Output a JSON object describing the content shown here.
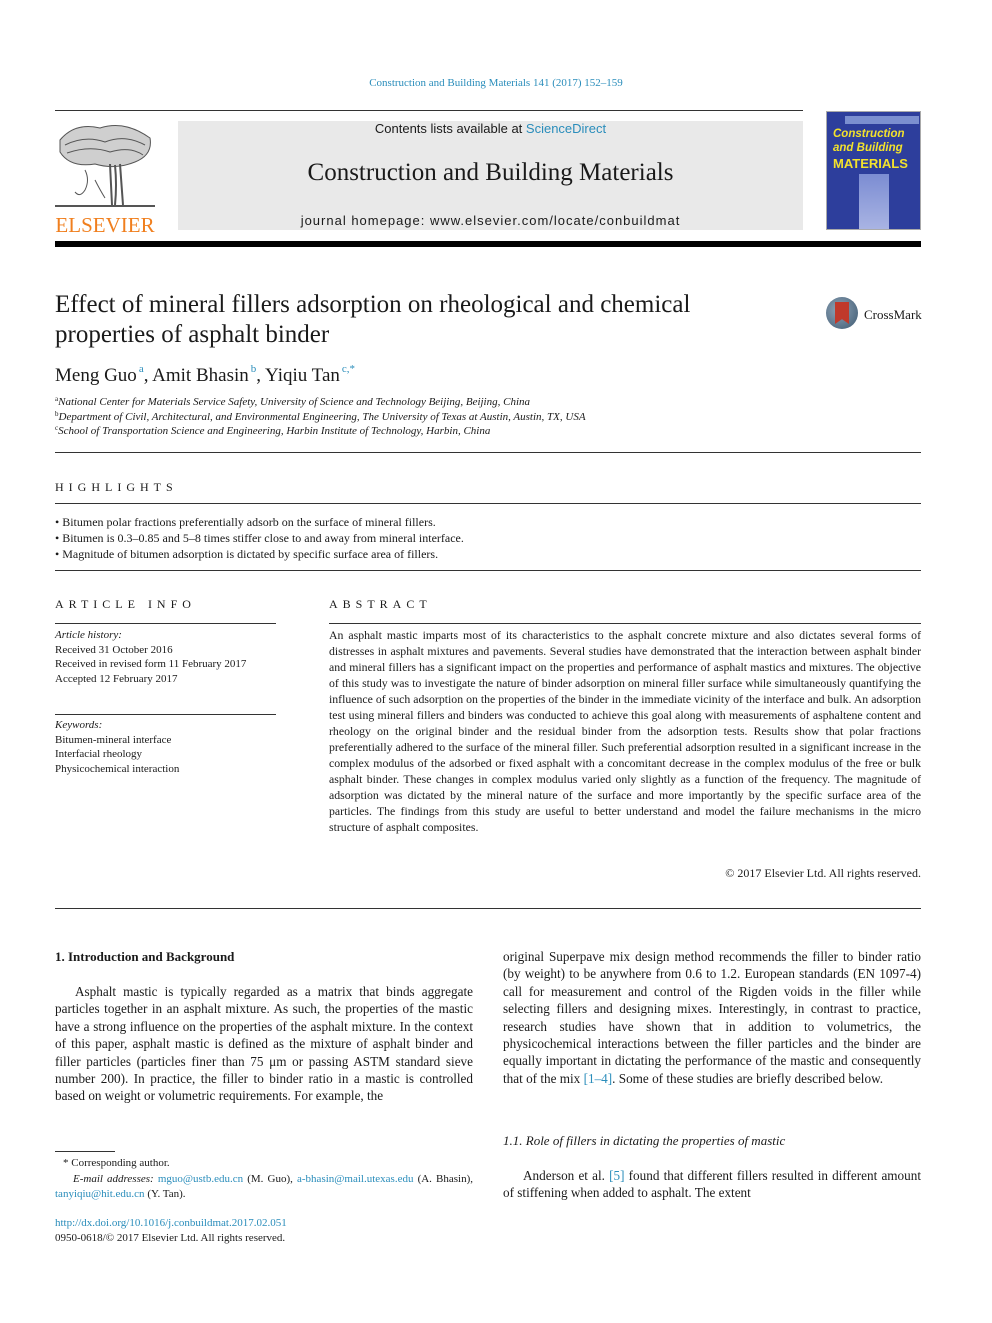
{
  "citation": "Construction and Building Materials 141 (2017) 152–159",
  "header": {
    "publisher": "ELSEVIER",
    "contents_prefix": "Contents lists available at ",
    "contents_link": "ScienceDirect",
    "journal_title": "Construction and Building Materials",
    "homepage": "journal homepage: www.elsevier.com/locate/conbuildmat",
    "cover": {
      "line1": "Construction",
      "line2": "and Building",
      "line3": "MATERIALS"
    }
  },
  "article": {
    "title": "Effect of mineral fillers adsorption on rheological and chemical properties of asphalt binder",
    "crossmark": "CrossMark",
    "authors": [
      {
        "name": "Meng Guo",
        "sup": "a",
        "sep": ", "
      },
      {
        "name": "Amit Bhasin",
        "sup": "b",
        "sep": ", "
      },
      {
        "name": "Yiqiu Tan",
        "sup": "c,*",
        "sep": ""
      }
    ],
    "affiliations": [
      {
        "sup": "a",
        "text": "National Center for Materials Service Safety, University of Science and Technology Beijing, Beijing, China"
      },
      {
        "sup": "b",
        "text": "Department of Civil, Architectural, and Environmental Engineering, The University of Texas at Austin, Austin, TX, USA"
      },
      {
        "sup": "c",
        "text": "School of Transportation Science and Engineering, Harbin Institute of Technology, Harbin, China"
      }
    ]
  },
  "highlights": {
    "heading": "HIGHLIGHTS",
    "items": [
      "Bitumen polar fractions preferentially adsorb on the surface of mineral fillers.",
      "Bitumen is 0.3–0.85 and 5–8 times stiffer close to and away from mineral interface.",
      "Magnitude of bitumen adsorption is dictated by specific surface area of fillers."
    ]
  },
  "article_info": {
    "heading": "ARTICLE INFO",
    "history_label": "Article history:",
    "history": [
      "Received 31 October 2016",
      "Received in revised form 11 February 2017",
      "Accepted 12 February 2017"
    ],
    "keywords_label": "Keywords:",
    "keywords": [
      "Bitumen-mineral interface",
      "Interfacial rheology",
      "Physicochemical interaction"
    ]
  },
  "abstract": {
    "heading": "ABSTRACT",
    "text": "An asphalt mastic imparts most of its characteristics to the asphalt concrete mixture and also dictates several forms of distresses in asphalt mixtures and pavements. Several studies have demonstrated that the interaction between asphalt binder and mineral fillers has a significant impact on the properties and performance of asphalt mastics and mixtures. The objective of this study was to investigate the nature of binder adsorption on mineral filler surface while simultaneously quantifying the influence of such adsorption on the properties of the binder in the immediate vicinity of the interface and bulk. An adsorption test using mineral fillers and binders was conducted to achieve this goal along with measurements of asphaltene content and rheology on the original binder and the residual binder from the adsorption tests. Results show that polar fractions preferentially adhered to the surface of the mineral filler. Such preferential adsorption resulted in a significant increase in the complex modulus of the adsorbed or fixed asphalt with a concomitant decrease in the complex modulus of the free or bulk asphalt binder. These changes in complex modulus varied only slightly as a function of the frequency. The magnitude of adsorption was dictated by the mineral nature of the surface and more importantly by the specific surface area of the particles. The findings from this study are useful to better understand and model the failure mechanisms in the micro structure of asphalt composites.",
    "copyright": "© 2017 Elsevier Ltd. All rights reserved."
  },
  "body": {
    "section1_heading": "1. Introduction and Background",
    "col1_paragraph": "Asphalt mastic is typically regarded as a matrix that binds aggregate particles together in an asphalt mixture. As such, the properties of the mastic have a strong influence on the properties of the asphalt mixture. In the context of this paper, asphalt mastic is defined as the mixture of asphalt binder and filler particles (particles finer than 75 μm or passing ASTM standard sieve number 200). In practice, the filler to binder ratio in a mastic is controlled based on weight or volumetric requirements. For example, the",
    "col2_paragraph_before_ref": "original Superpave mix design method recommends the filler to binder ratio (by weight) to be anywhere from 0.6 to 1.2. European standards (EN 1097-4) call for measurement and control of the Rigden voids in the filler while selecting fillers and designing mixes. Interestingly, in contrast to practice, research studies have shown that in addition to volumetrics, the physicochemical interactions between the filler particles and the binder are equally important in dictating the performance of the mastic and consequently that of the mix ",
    "col2_ref1": "[1–4]",
    "col2_paragraph_after_ref": ". Some of these studies are briefly described below.",
    "subsection_heading": "1.1. Role of fillers in dictating the properties of mastic",
    "sub_para_before_ref": "Anderson et al. ",
    "sub_ref": "[5]",
    "sub_para_after_ref": " found that different fillers resulted in different amount of stiffening when added to asphalt. The extent"
  },
  "footnotes": {
    "corresponding": "* Corresponding author.",
    "email_label": "E-mail addresses:",
    "emails": [
      {
        "addr": "mguo@ustb.edu.cn",
        "who": " (M. Guo), "
      },
      {
        "addr": "a-bhasin@mail.utexas.edu",
        "who": " (A. Bhasin), "
      },
      {
        "addr": "tanyiqiu@hit.edu.cn",
        "who": " (Y. Tan)."
      }
    ],
    "doi": "http://dx.doi.org/10.1016/j.conbuildmat.2017.02.051",
    "issn": "0950-0618/© 2017 Elsevier Ltd. All rights reserved."
  }
}
